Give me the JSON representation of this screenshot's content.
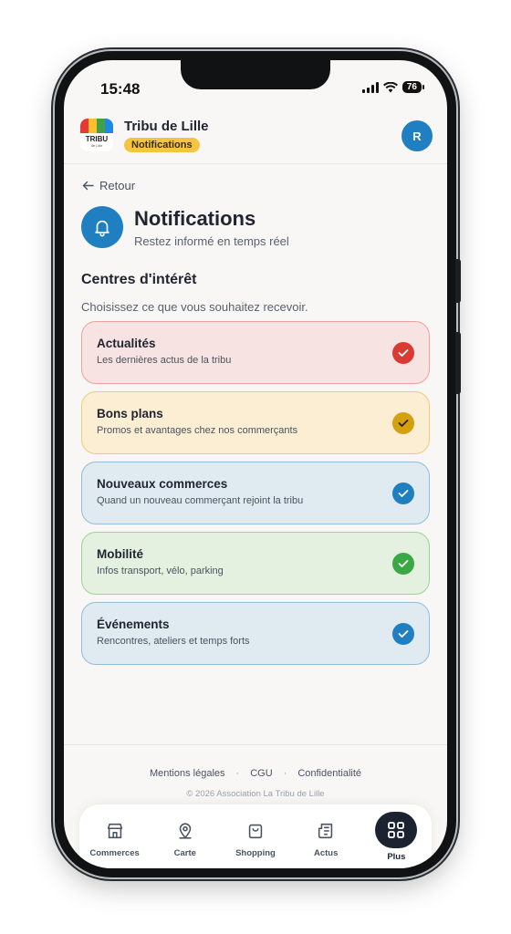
{
  "status": {
    "time": "15:48",
    "battery": "76"
  },
  "app": {
    "name": "Tribu de Lille",
    "badge": "Notifications",
    "logo_text": "TRIBU",
    "logo_sub": "de Lille",
    "avatar_initial": "R"
  },
  "nav": {
    "back_label": "Retour"
  },
  "page": {
    "title": "Notifications",
    "subtitle": "Restez informé en temps réel"
  },
  "section": {
    "title": "Centres d'intérêt",
    "description": "Choisissez ce que vous souhaitez recevoir."
  },
  "interests": [
    {
      "title": "Actualités",
      "description": "Les dernières actus de la tribu",
      "checked": true,
      "bg": "#f7e3e1",
      "border": "#e9a39c",
      "check": "#d93b33"
    },
    {
      "title": "Bons plans",
      "description": "Promos et avantages chez nos commerçants",
      "checked": true,
      "bg": "#fbeed2",
      "border": "#efcb7c",
      "check": "#d4a00e"
    },
    {
      "title": "Nouveaux commerces",
      "description": "Quand un nouveau commerçant rejoint la tribu",
      "checked": true,
      "bg": "#e0eaf1",
      "border": "#92bcd9",
      "check": "#1f7fc0"
    },
    {
      "title": "Mobilité",
      "description": "Infos transport, vélo, parking",
      "checked": true,
      "bg": "#e4f0e0",
      "border": "#9ed19a",
      "check": "#3aa845"
    },
    {
      "title": "Événements",
      "description": "Rencontres, ateliers et temps forts",
      "checked": true,
      "bg": "#e0eaf1",
      "border": "#92bcd9",
      "check": "#1f7fc0"
    }
  ],
  "footer": {
    "links": [
      "Mentions légales",
      "CGU",
      "Confidentialité"
    ],
    "copyright": "© 2026 Association La Tribu de Lille"
  },
  "tabs": [
    {
      "label": "Commerces",
      "icon": "store-icon"
    },
    {
      "label": "Carte",
      "icon": "map-pin-icon"
    },
    {
      "label": "Shopping",
      "icon": "shopping-bag-icon"
    },
    {
      "label": "Actus",
      "icon": "newspaper-icon"
    },
    {
      "label": "Plus",
      "icon": "grid-icon",
      "active": true
    }
  ],
  "colors": {
    "primary": "#1f7fc0",
    "badge": "#f5c542",
    "tab_active": "#1b2230"
  }
}
